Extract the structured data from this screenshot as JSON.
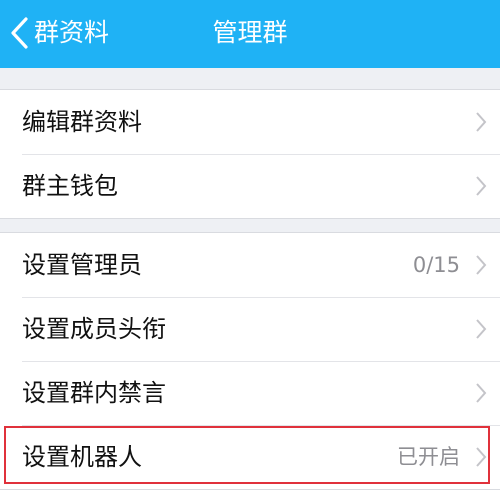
{
  "nav": {
    "back_label": "群资料",
    "title": "管理群"
  },
  "colors": {
    "nav_background": "#1fb2f5",
    "highlight_border": "#e0313b"
  },
  "icons": {
    "back": "chevron-left-icon",
    "row_disclosure": "chevron-right-icon"
  },
  "sections": [
    {
      "items": [
        {
          "label": "编辑群资料"
        },
        {
          "label": "群主钱包"
        }
      ]
    },
    {
      "items": [
        {
          "label": "设置管理员",
          "value": "0/15"
        },
        {
          "label": "设置成员头衔"
        },
        {
          "label": "设置群内禁言"
        },
        {
          "label": "设置机器人",
          "value": "已开启",
          "highlighted": true
        }
      ]
    }
  ]
}
